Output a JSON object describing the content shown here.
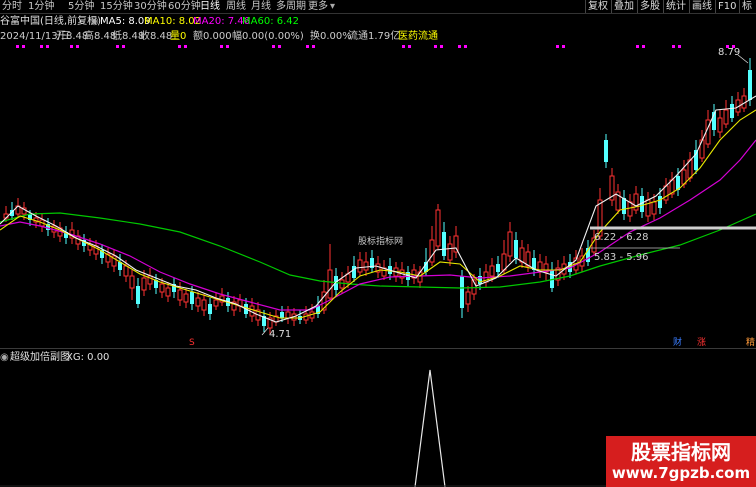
{
  "toolbar": {
    "periods": [
      "分时",
      "1分钟",
      "5分钟",
      "15分钟",
      "30分钟",
      "60分钟",
      "日线",
      "周线",
      "月线",
      "多周期",
      "更多"
    ],
    "active": "日线",
    "buttons": [
      "复权",
      "叠加",
      "多股",
      "统计",
      "画线",
      "F10",
      "标"
    ]
  },
  "stock": {
    "name": "谷富中国(日线,前复权)",
    "ma5_label": "MA5: 8.09",
    "ma10_label": "MA10: 8.02",
    "ma20_label": "MA20: 7.46",
    "ma60_label": "MA60: 6.42",
    "detail_date": "2024/11/13/三",
    "detail_open": "开8.48",
    "detail_high": "高8.48",
    "detail_low": "低8.48",
    "detail_close": "收8.48",
    "detail_vol": "量0",
    "detail_amount": "额0.000",
    "detail_amp": "幅0.00(0.00%)",
    "detail_turnover": "换0.00%",
    "detail_float": "流通1.79亿",
    "detail_sector": "医药流通"
  },
  "colors": {
    "ma5": "#ffffff",
    "ma10": "#ffff00",
    "ma20": "#ff00ff",
    "ma60": "#00ff00",
    "up": "#ff3232",
    "down": "#54ffff",
    "dots": "#ff00ff"
  },
  "annotations": {
    "high_label": "8.79",
    "low_label": "4.71",
    "zone1": "6.22 - 6.28",
    "zone2": "5.83 - 5.96",
    "center_watermark": "股标指标网"
  },
  "badges": {
    "b1": "S",
    "b2": "财",
    "b3": "涨",
    "b4": "精"
  },
  "subchart": {
    "title": "超级加倍副图",
    "xg_label": "XG: 0.00"
  },
  "watermark": {
    "title": "股票指标网",
    "url": "www.7gpzb.com"
  }
}
